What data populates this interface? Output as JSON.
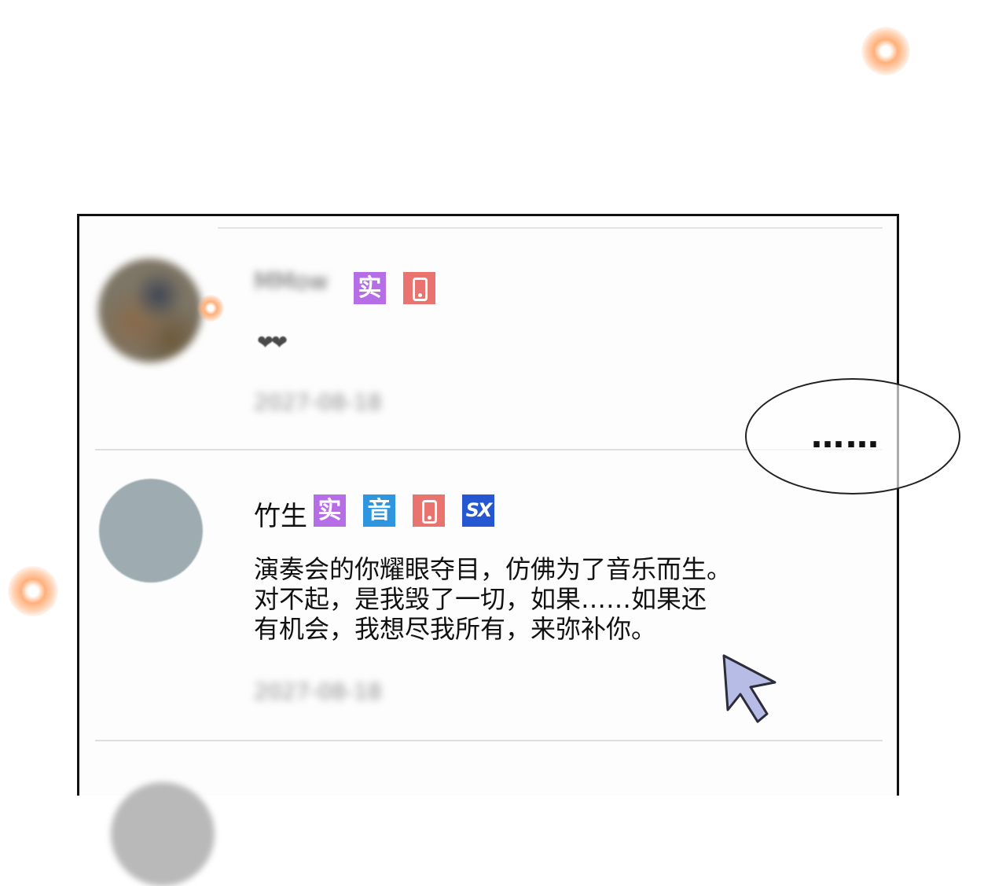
{
  "comments": [
    {
      "user": "MMow",
      "badges": [
        {
          "type": "real-name",
          "label": "实",
          "color": "#b56ee5"
        },
        {
          "type": "phone",
          "icon": "phone-icon",
          "color": "#e8736f"
        }
      ],
      "content": "❤❤",
      "time": "2027-08-18"
    },
    {
      "user": "竹生",
      "badges": [
        {
          "type": "real-name",
          "label": "实",
          "color": "#b56ee5"
        },
        {
          "type": "music",
          "label": "音",
          "color": "#2e96de"
        },
        {
          "type": "phone",
          "icon": "phone-icon",
          "color": "#e8736f"
        },
        {
          "type": "sx",
          "label": "SX",
          "color": "#2557d1"
        }
      ],
      "content_lines": [
        "演奏会的你耀眼夺目，仿佛为了音乐而生。",
        "对不起，是我毁了一切，如果……如果还",
        "有机会，我想尽我所有，来弥补你。"
      ],
      "time": "2027-08-18"
    }
  ],
  "speech_bubble": {
    "text": "……"
  },
  "decor": {
    "panel_border": "#111111",
    "cursor_fill": "#b7bce6",
    "glow_color": "#ffb07a"
  }
}
